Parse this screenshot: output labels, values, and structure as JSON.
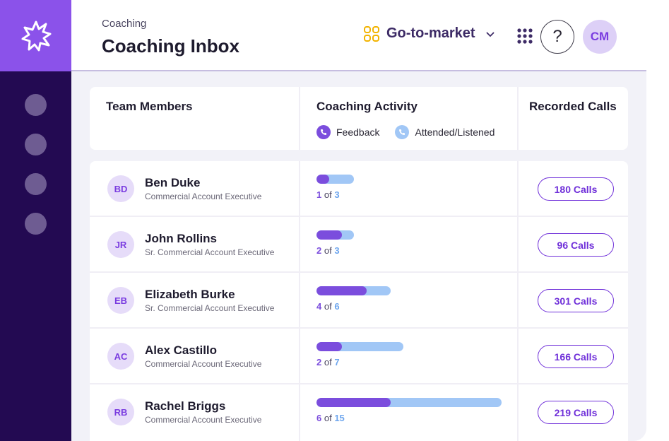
{
  "header": {
    "breadcrumb": "Coaching",
    "title": "Coaching Inbox",
    "workspace": "Go-to-market",
    "help_label": "?",
    "user_initials": "CM"
  },
  "colors": {
    "sidebar": "#230a52",
    "logo_bg": "#8b52ea",
    "feedback": "#7b4ddd",
    "attended": "#a1c7f6",
    "accent": "#6f2fd9"
  },
  "sidebar": {
    "items": [
      {
        "icon": "nav-dot"
      },
      {
        "icon": "nav-dot"
      },
      {
        "icon": "nav-dot"
      },
      {
        "icon": "nav-dot"
      }
    ]
  },
  "table": {
    "columns": [
      "Team Members",
      "Coaching Activity",
      "Recorded Calls"
    ],
    "legend": [
      {
        "label": "Feedback",
        "icon": "phone-icon"
      },
      {
        "label": "Attended/Listened",
        "icon": "phone-icon"
      }
    ],
    "count_separator": "of",
    "rows": [
      {
        "initials": "BD",
        "name": "Ben Duke",
        "role": "Commercial Account Executive",
        "feedback": 1,
        "total": 3,
        "calls": "180 Calls"
      },
      {
        "initials": "JR",
        "name": "John Rollins",
        "role": "Sr. Commercial Account Executive",
        "feedback": 2,
        "total": 3,
        "calls": "96 Calls"
      },
      {
        "initials": "EB",
        "name": "Elizabeth Burke",
        "role": "Sr. Commercial Account Executive",
        "feedback": 4,
        "total": 6,
        "calls": "301 Calls"
      },
      {
        "initials": "AC",
        "name": "Alex Castillo",
        "role": "Commercial Account Executive",
        "feedback": 2,
        "total": 7,
        "calls": "166 Calls"
      },
      {
        "initials": "RB",
        "name": "Rachel Briggs",
        "role": "Commercial Account Executive",
        "feedback": 6,
        "total": 15,
        "calls": "219 Calls"
      }
    ]
  }
}
